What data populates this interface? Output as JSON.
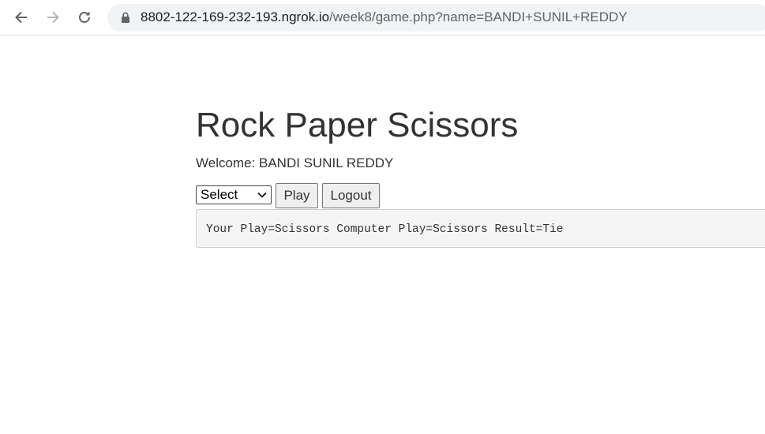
{
  "browser": {
    "url_host": "8802-122-169-232-193.ngrok.io",
    "url_path": "/week8/game.php?name=BANDI+SUNIL+REDDY",
    "icons": [
      "back-icon",
      "forward-icon",
      "reload-icon",
      "lock-icon"
    ]
  },
  "page": {
    "title": "Rock Paper Scissors",
    "welcome": "Welcome: BANDI SUNIL REDDY",
    "select_value": "Select",
    "play_label": "Play",
    "logout_label": "Logout",
    "result_text": "Your Play=Scissors Computer Play=Scissors Result=Tie"
  },
  "colors": {
    "text": "#333333",
    "result_bg": "#f5f5f5",
    "omnibox_bg": "#f1f3f4"
  }
}
